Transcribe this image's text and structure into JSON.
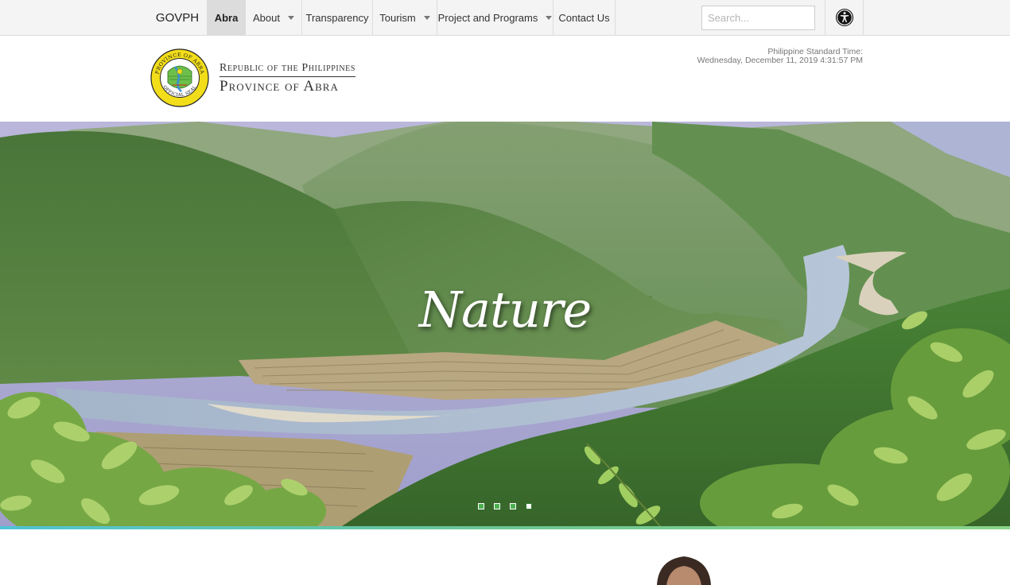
{
  "nav": {
    "brand": "GOVPH",
    "items": [
      {
        "label": "Abra",
        "active": true,
        "dropdown": false
      },
      {
        "label": "About",
        "active": false,
        "dropdown": true
      },
      {
        "label": "Transparency",
        "active": false,
        "dropdown": false
      },
      {
        "label": "Tourism",
        "active": false,
        "dropdown": true
      },
      {
        "label": "Project and Programs",
        "active": false,
        "dropdown": true
      },
      {
        "label": "Contact Us",
        "active": false,
        "dropdown": false
      }
    ],
    "search_placeholder": "Search...",
    "search_value": "",
    "accessibility_icon": "accessibility-icon"
  },
  "header": {
    "seal_icon": "official-seal-icon",
    "seal_ring_text": "PROVINCE OF ABRA",
    "seal_bottom_text": "OFFICIAL SEAL",
    "republic": "Republic of the Philippines",
    "province": "Province of Abra",
    "pst_label": "Philippine Standard Time:",
    "pst_value": "Wednesday, December 11, 2019 4:31:57 PM"
  },
  "hero": {
    "caption": "Nature",
    "slide_count": 4,
    "active_slide": 4
  },
  "colors": {
    "nav_bg": "#f4f4f4",
    "nav_active": "#dcdcdc",
    "accent_rule_start": "#4fc3d6",
    "accent_rule_end": "#8bd48a",
    "slide_dot": "#4caf50"
  }
}
